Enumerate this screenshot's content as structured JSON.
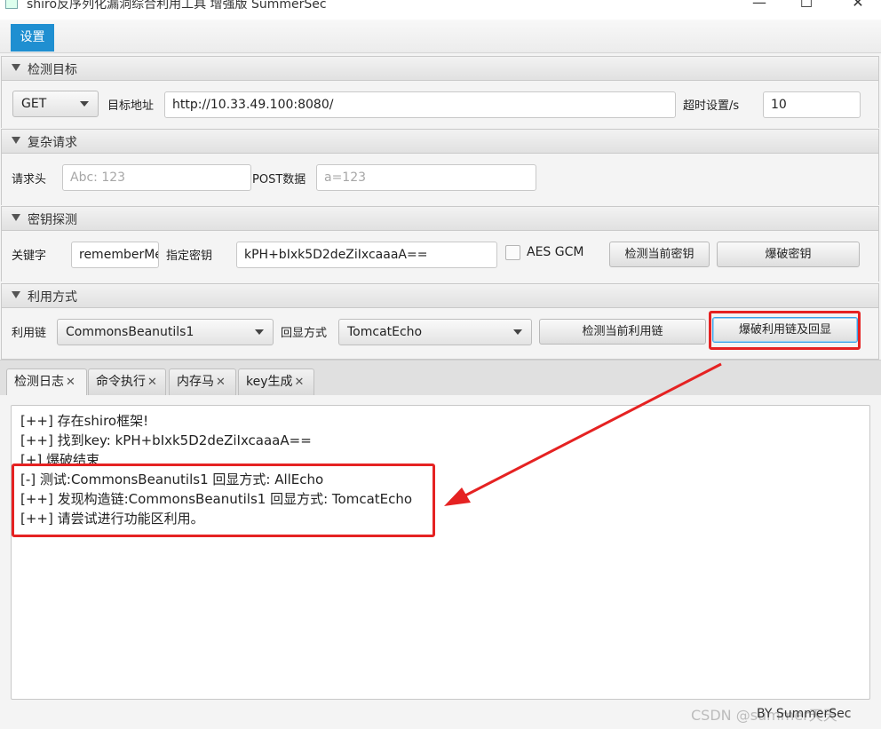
{
  "window": {
    "title": "shiro反序列化漏洞综合利用工具 增强版 SummerSec",
    "min_glyph": "—",
    "max_glyph": "☐",
    "close_glyph": "✕"
  },
  "menu": {
    "settings": "设置"
  },
  "sections": {
    "target": {
      "header": "检测目标",
      "method": "GET",
      "url_label": "目标地址",
      "url_value": "http://10.33.49.100:8080/",
      "timeout_label": "超时设置/s",
      "timeout_value": "10"
    },
    "complex": {
      "header": "复杂请求",
      "headers_label": "请求头",
      "headers_placeholder": "Abc: 123",
      "post_label": "POST数据",
      "post_placeholder": "a=123"
    },
    "key": {
      "header": "密钥探测",
      "keyword_label": "关键字",
      "keyword_value": "rememberMe",
      "key_label": "指定密钥",
      "key_value": "kPH+bIxk5D2deZiIxcaaaA==",
      "aes_gcm_label": "AES GCM",
      "check_key_button": "检测当前密钥",
      "brute_key_button": "爆破密钥"
    },
    "exploit": {
      "header": "利用方式",
      "chain_label": "利用链",
      "chain_value": "CommonsBeanutils1",
      "echo_label": "回显方式",
      "echo_value": "TomcatEcho",
      "check_chain_button": "检测当前利用链",
      "brute_chain_button": "爆破利用链及回显"
    }
  },
  "tabs": [
    {
      "label": "检测日志"
    },
    {
      "label": "命令执行"
    },
    {
      "label": "内存马"
    },
    {
      "label": "key生成"
    }
  ],
  "tab_close_glyph": "✕",
  "log_lines": [
    "[++] 存在shiro框架!",
    "[++] 找到key:  kPH+bIxk5D2deZiIxcaaaA==",
    "[+] 爆破结束",
    "[-] 测试:CommonsBeanutils1  回显方式: AllEcho",
    "[++] 发现构造链:CommonsBeanutils1  回显方式: TomcatEcho",
    "[++] 请尝试进行功能区利用。"
  ],
  "footer": {
    "by": "BY SummerSec"
  },
  "watermark": "CSDN @summer天天",
  "colors": {
    "accent": "#1f8fd1",
    "highlight": "#e52222"
  }
}
